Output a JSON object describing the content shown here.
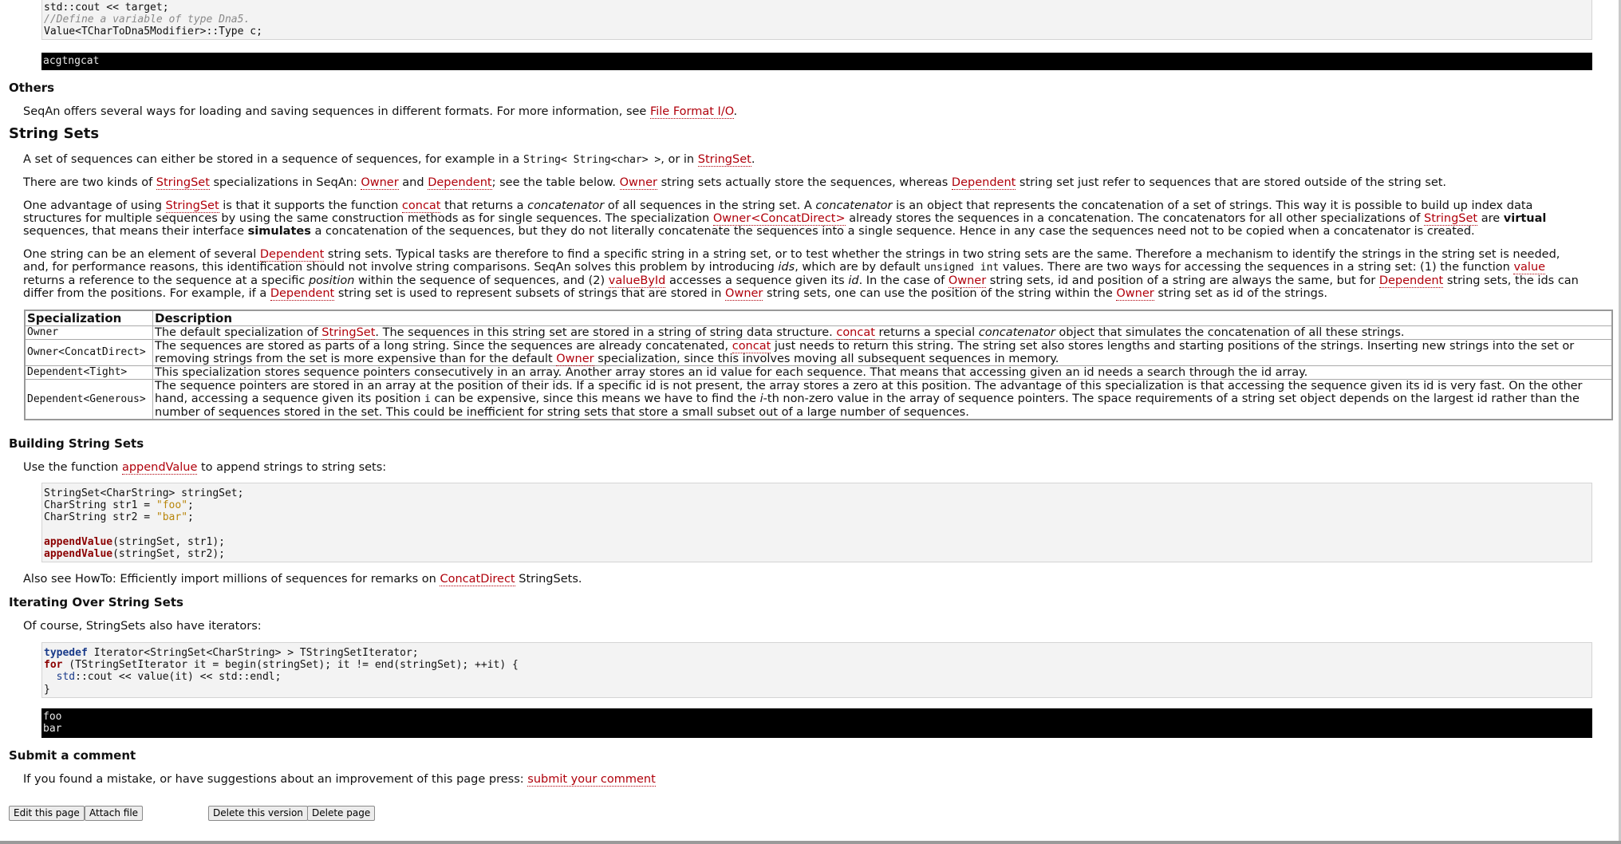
{
  "top_code": {
    "line1": "std::cout << target;",
    "comment": "//Define a variable of type Dna5.",
    "line3": "Value<TCharToDna5Modifier>::Type c;"
  },
  "top_output": "acgtngcat",
  "others": {
    "heading": "Others",
    "text_before": "SeqAn offers several ways for loading and saving sequences in different formats. For more information, see ",
    "link": "File Format I/O",
    "text_after": "."
  },
  "string_sets": {
    "heading": "String Sets",
    "p1": {
      "a": "A set of sequences can either be stored in a sequence of sequences, for example in a ",
      "code": "String< String<char> >",
      "b": ", or in ",
      "link": "StringSet",
      "c": "."
    },
    "p2": {
      "a": "There are two kinds of ",
      "l1": "StringSet",
      "b": " specializations in SeqAn: ",
      "l2": "Owner",
      "c": " and ",
      "l3": "Dependent",
      "d": "; see the table below. ",
      "l4": "Owner",
      "e": " string sets actually store the sequences, whereas ",
      "l5": "Dependent",
      "f": " string set just refer to sequences that are stored outside of the string set."
    },
    "p3": {
      "a": "One advantage of using ",
      "l1": "StringSet",
      "b": " is that it supports the function ",
      "l2": "concat",
      "c": " that returns a ",
      "i1": "concatenator",
      "d": " of all sequences in the string set. A ",
      "i2": "concatenator",
      "e": " is an object that represents the concatenation of a set of strings. This way it is possible to build up index data structures for multiple sequences by using the same construction methods as for single sequences. The specialization ",
      "l3": "Owner<ConcatDirect>",
      "f": " already stores the sequences in a concatenation. The concatenators for all other specializations of ",
      "l4": "StringSet",
      "g": " are ",
      "b1": "virtual",
      "h": " sequences, that means their interface ",
      "b2": "simulates",
      "i": " a concatenation of the sequences, but they do not literally concatenate the sequences into a single sequence. Hence in any case the sequences need not to be copied when a concatenator is created."
    },
    "p4": {
      "a": "One string can be an element of several ",
      "l1": "Dependent",
      "b": " string sets. Typical tasks are therefore to find a specific string in a string set, or to test whether the strings in two string sets are the same. Therefore a mechanism to identify the strings in the string set is needed, and, for performance reasons, this identification should not involve string comparisons. SeqAn solves this problem by introducing ",
      "i1": "ids",
      "c": ", which are by default ",
      "code": "unsigned int",
      "d": " values. There are two ways for accessing the sequences in a string set: (1) the function ",
      "l2": "value",
      "e": " returns a reference to the sequence at a specific ",
      "i2": "position",
      "f": " within the sequence of sequences, and (2) ",
      "l3": "valueById",
      "g": " accesses a sequence given its ",
      "i3": "id",
      "h": ". In the case of ",
      "l4": "Owner",
      "i": " string sets, id and position of a string are always the same, but for ",
      "l5": "Dependent",
      "j": " string sets, the ids can differ from the positions. For example, if a ",
      "l6": "Dependent",
      "k": " string set is used to represent subsets of strings that are stored in ",
      "l7": "Owner",
      "l": " string sets, one can use the position of the string within the ",
      "l8": "Owner",
      "m": " string set as id of the strings."
    }
  },
  "table": {
    "headers": [
      "Specialization",
      "Description"
    ],
    "rows": [
      {
        "spec": "Owner",
        "a": "The default specialization of ",
        "link1": "StringSet",
        "b": ". The sequences in this string set are stored in a string of string data structure. ",
        "link2": "concat",
        "c": " returns a special ",
        "i": "concatenator",
        "d": " object that simulates the concatenation of all these strings."
      },
      {
        "spec": "Owner<ConcatDirect>",
        "a": "The sequences are stored as parts of a long string. Since the sequences are already concatenated, ",
        "link1": "concat",
        "b": " just needs to return this string. The string set also stores lengths and starting positions of the strings. Inserting new strings into the set or removing strings from the set is more expensive than for the default ",
        "link2": "Owner",
        "c": " specialization, since this involves moving all subsequent sequences in memory."
      },
      {
        "spec": "Dependent<Tight>",
        "a": "This specialization stores sequence pointers consecutively in an array. Another array stores an id value for each sequence. That means that accessing given an id needs a search through the id array."
      },
      {
        "spec": "Dependent<Generous>",
        "a": "The sequence pointers are stored in an array at the position of their ids. If a specific id is not present, the array stores a zero at this position. The advantage of this specialization is that accessing the sequence given its id is very fast. On the other hand, accessing a sequence given its position ",
        "code": "i",
        "b": " can be expensive, since this means we have to find the ",
        "i": "i",
        "c": "-th non-zero value in the array of sequence pointers. The space requirements of a string set object depends on the largest id rather than the number of sequences stored in the set. This could be inefficient for string sets that store a small subset out of a large number of sequences."
      }
    ]
  },
  "building": {
    "heading": "Building String Sets",
    "text_a": "Use the function ",
    "link": "appendValue",
    "text_b": " to append strings to string sets:",
    "code": {
      "l1": "StringSet<CharString> stringSet;",
      "l2a": "CharString str1 = ",
      "l2s": "\"foo\"",
      "l2b": ";",
      "l3a": "CharString str2 = ",
      "l3s": "\"bar\"",
      "l3b": ";",
      "fn": "appendValue",
      "l5": "(stringSet, str1);",
      "l6": "(stringSet, str2);"
    },
    "also_a": "Also see HowTo: Efficiently import millions of sequences for remarks on ",
    "also_link": "ConcatDirect",
    "also_b": " StringSets."
  },
  "iterating": {
    "heading": "Iterating Over String Sets",
    "text": "Of course, StringSets also have iterators:",
    "code": {
      "kw1": "typedef",
      "l1": " Iterator<StringSet<CharString> > TStringSetIterator;",
      "kw2": "for",
      "l2": " (TStringSetIterator it = begin(stringSet); it != end(stringSet); ++it) {",
      "ns": "std",
      "l3": "::cout << value(it) << std::endl;",
      "l4": "}"
    },
    "output": [
      "foo",
      "bar"
    ]
  },
  "comment": {
    "heading": "Submit a comment",
    "text": "If you found a mistake, or have suggestions about an improvement of this page press: ",
    "link": "submit your comment"
  },
  "buttons": {
    "edit": "Edit this page",
    "attach": "Attach file",
    "delete_version": "Delete this version",
    "delete_page": "Delete page"
  }
}
